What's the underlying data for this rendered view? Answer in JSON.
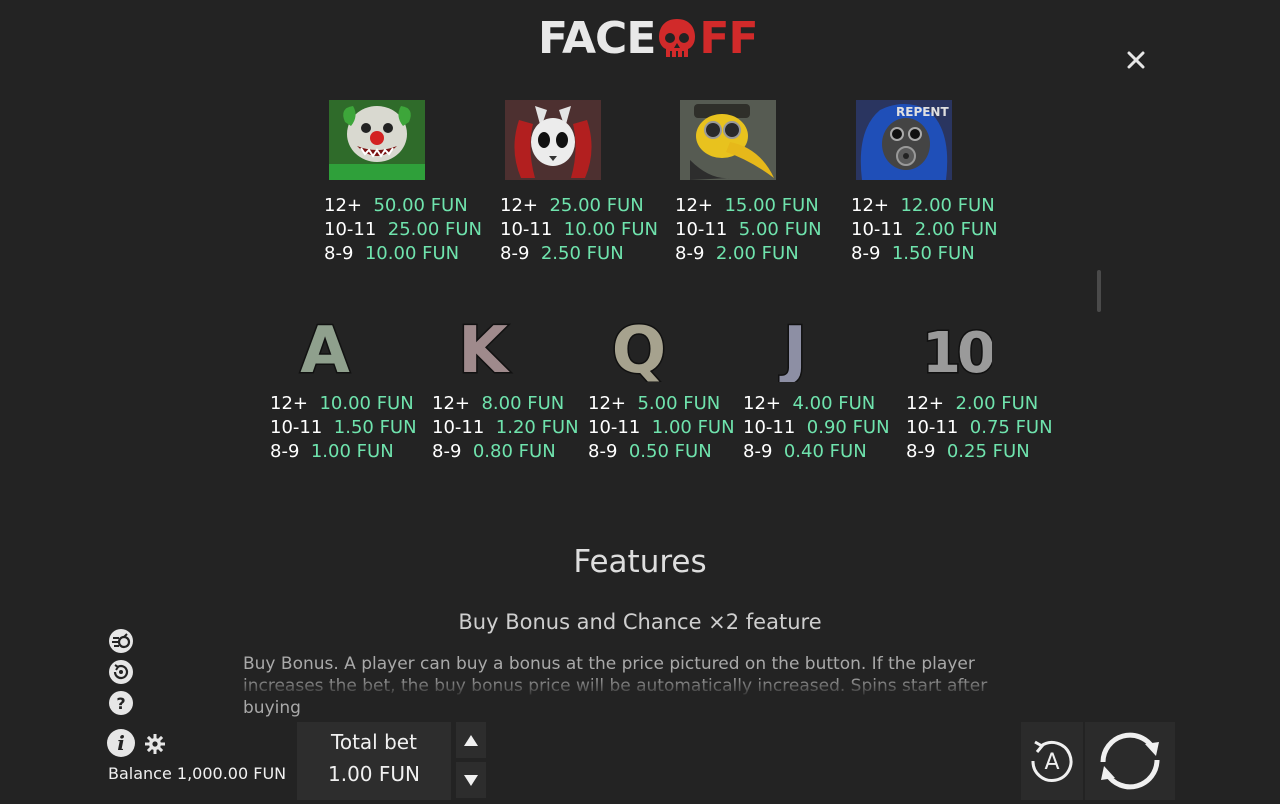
{
  "header": {
    "logo_text": "FACEOFF",
    "close_icon": "close-icon"
  },
  "paytable": {
    "row1": [
      {
        "symbol": "clown",
        "pays": [
          {
            "count": "12+",
            "amount": "50.00 FUN"
          },
          {
            "count": "10-11",
            "amount": "25.00 FUN"
          },
          {
            "count": "8-9",
            "amount": "10.00 FUN"
          }
        ]
      },
      {
        "symbol": "rabbit-mask",
        "pays": [
          {
            "count": "12+",
            "amount": "25.00 FUN"
          },
          {
            "count": "10-11",
            "amount": "10.00 FUN"
          },
          {
            "count": "8-9",
            "amount": "2.50 FUN"
          }
        ]
      },
      {
        "symbol": "plague-doctor",
        "pays": [
          {
            "count": "12+",
            "amount": "15.00 FUN"
          },
          {
            "count": "10-11",
            "amount": "5.00 FUN"
          },
          {
            "count": "8-9",
            "amount": "2.00 FUN"
          }
        ]
      },
      {
        "symbol": "gas-mask",
        "label": "REPENT",
        "pays": [
          {
            "count": "12+",
            "amount": "12.00 FUN"
          },
          {
            "count": "10-11",
            "amount": "2.00 FUN"
          },
          {
            "count": "8-9",
            "amount": "1.50 FUN"
          }
        ]
      }
    ],
    "row2": [
      {
        "symbol": "A",
        "pays": [
          {
            "count": "12+",
            "amount": "10.00 FUN"
          },
          {
            "count": "10-11",
            "amount": "1.50 FUN"
          },
          {
            "count": "8-9",
            "amount": "1.00 FUN"
          }
        ]
      },
      {
        "symbol": "K",
        "pays": [
          {
            "count": "12+",
            "amount": "8.00 FUN"
          },
          {
            "count": "10-11",
            "amount": "1.20 FUN"
          },
          {
            "count": "8-9",
            "amount": "0.80 FUN"
          }
        ]
      },
      {
        "symbol": "Q",
        "pays": [
          {
            "count": "12+",
            "amount": "5.00 FUN"
          },
          {
            "count": "10-11",
            "amount": "1.00 FUN"
          },
          {
            "count": "8-9",
            "amount": "0.50 FUN"
          }
        ]
      },
      {
        "symbol": "J",
        "pays": [
          {
            "count": "12+",
            "amount": "4.00 FUN"
          },
          {
            "count": "10-11",
            "amount": "0.90 FUN"
          },
          {
            "count": "8-9",
            "amount": "0.40 FUN"
          }
        ]
      },
      {
        "symbol": "10",
        "pays": [
          {
            "count": "12+",
            "amount": "2.00 FUN"
          },
          {
            "count": "10-11",
            "amount": "0.75 FUN"
          },
          {
            "count": "8-9",
            "amount": "0.25 FUN"
          }
        ]
      }
    ]
  },
  "features": {
    "title": "Features",
    "subtitle": "Buy Bonus and Chance ×2 feature",
    "text": "Buy Bonus. A player can buy a bonus at the price pictured on the button. If the player increases the bet, the buy bonus price will be automatically increased. Spins start after buying"
  },
  "controls": {
    "side_icons": [
      "turbo-icon",
      "history-icon",
      "help-icon"
    ],
    "info_icon": "info-icon",
    "settings_icon": "gear-icon",
    "balance": "Balance 1,000.00 FUN",
    "total_bet_label": "Total bet",
    "total_bet_value": "1.00 FUN",
    "autoplay_label": "A",
    "spin_icon": "spin-icon"
  },
  "colors": {
    "background": "#232323",
    "amount": "#6fe3ad",
    "logo_red": "#d12a2a"
  }
}
